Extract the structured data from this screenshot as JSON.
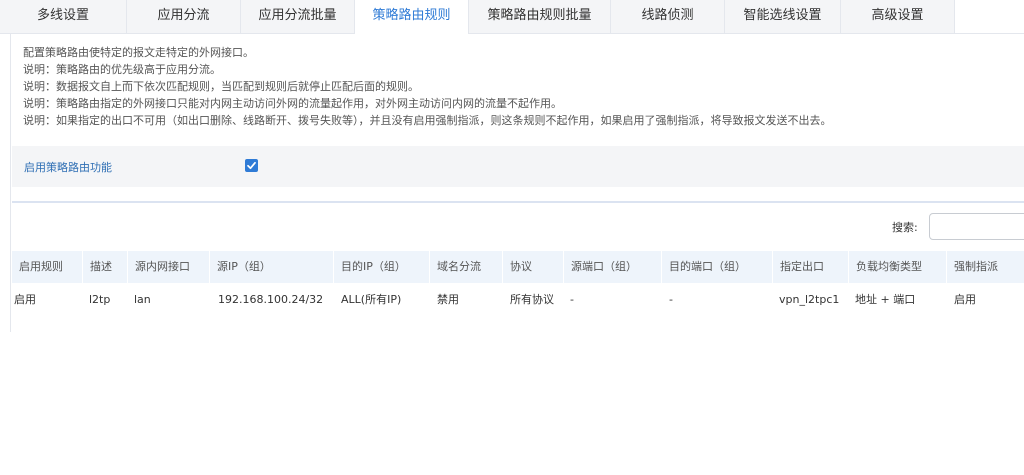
{
  "tabs": [
    {
      "label": "多线设置"
    },
    {
      "label": "应用分流"
    },
    {
      "label": "应用分流批量"
    },
    {
      "label": "策略路由规则"
    },
    {
      "label": "策略路由规则批量"
    },
    {
      "label": "线路侦测"
    },
    {
      "label": "智能选线设置"
    },
    {
      "label": "高级设置"
    }
  ],
  "active_tab": "策略路由规则",
  "notes": [
    "配置策略路由使特定的报文走特定的外网接口。",
    "说明：策略路由的优先级高于应用分流。",
    "说明：数据报文自上而下依次匹配规则，当匹配到规则后就停止匹配后面的规则。",
    "说明：策略路由指定的外网接口只能对内网主动访问外网的流量起作用，对外网主动访问内网的流量不起作用。",
    "说明：如果指定的出口不可用（如出口删除、线路断开、拨号失败等），并且没有启用强制指派，则这条规则不起作用，如果启用了强制指派，将导致报文发送不出去。"
  ],
  "enable": {
    "label": "启用策略路由功能",
    "checked": true
  },
  "search": {
    "label": "搜索:",
    "value": ""
  },
  "table": {
    "columns": [
      "启用规则",
      "描述",
      "源内网接口",
      "源IP（组）",
      "目的IP（组）",
      "域名分流",
      "协议",
      "源端口（组）",
      "目的端口（组）",
      "指定出口",
      "负载均衡类型",
      "强制指派"
    ],
    "rows": [
      [
        "启用",
        "l2tp",
        "lan",
        "192.168.100.24/32",
        "ALL(所有IP)",
        "禁用",
        "所有协议",
        "-",
        "-",
        "vpn_l2tpc1",
        "地址 + 端口",
        "启用"
      ]
    ]
  },
  "colors": {
    "accent": "#2f7bd6",
    "header_bg": "#eef4fb",
    "panel_bg": "#f4f5f7"
  }
}
